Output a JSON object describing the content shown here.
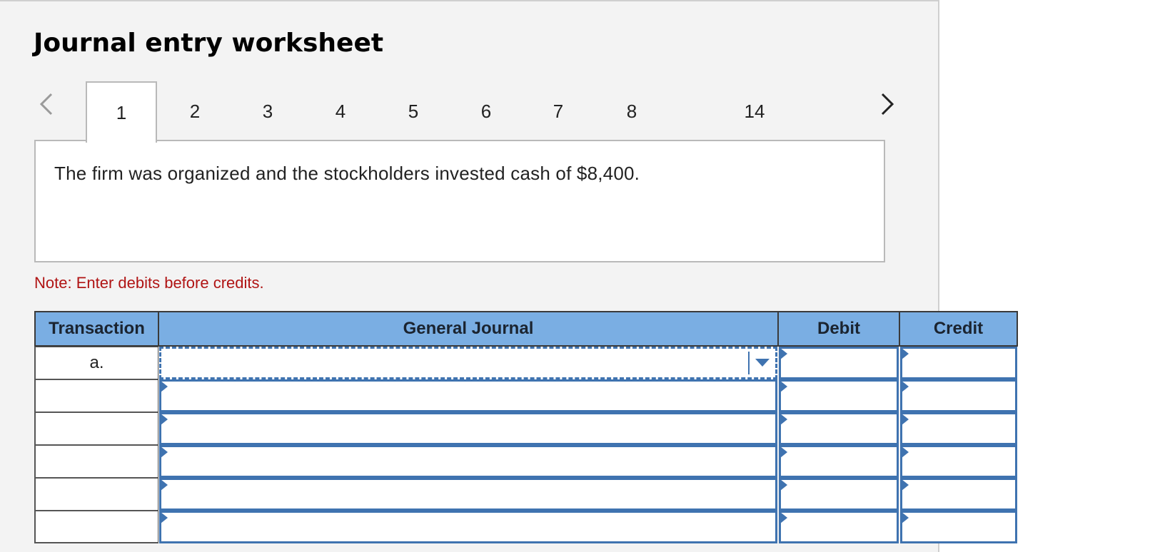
{
  "worksheet": {
    "title": "Journal entry worksheet",
    "tabs": [
      {
        "label": "1",
        "active": true
      },
      {
        "label": "2"
      },
      {
        "label": "3"
      },
      {
        "label": "4"
      },
      {
        "label": "5"
      },
      {
        "label": "6"
      },
      {
        "label": "7"
      },
      {
        "label": "8"
      },
      {
        "label": "14"
      }
    ],
    "nav_prev_icon": "chevron-left-icon",
    "nav_next_icon": "chevron-right-icon",
    "description": "The firm was organized and the stockholders invested cash of $8,400.",
    "note": "Note: Enter debits before credits."
  },
  "journal": {
    "headers": {
      "transaction": "Transaction",
      "general_journal": "General Journal",
      "debit": "Debit",
      "credit": "Credit"
    },
    "rows": [
      {
        "transaction": "a.",
        "account": "",
        "debit": "",
        "credit": ""
      },
      {
        "transaction": "",
        "account": "",
        "debit": "",
        "credit": ""
      },
      {
        "transaction": "",
        "account": "",
        "debit": "",
        "credit": ""
      },
      {
        "transaction": "",
        "account": "",
        "debit": "",
        "credit": ""
      },
      {
        "transaction": "",
        "account": "",
        "debit": "",
        "credit": ""
      },
      {
        "transaction": "",
        "account": "",
        "debit": "",
        "credit": ""
      }
    ]
  },
  "colors": {
    "header_bg": "#7aaee3",
    "input_border": "#3f73b0",
    "note_text": "#b01414",
    "panel_bg": "#f3f3f3"
  }
}
